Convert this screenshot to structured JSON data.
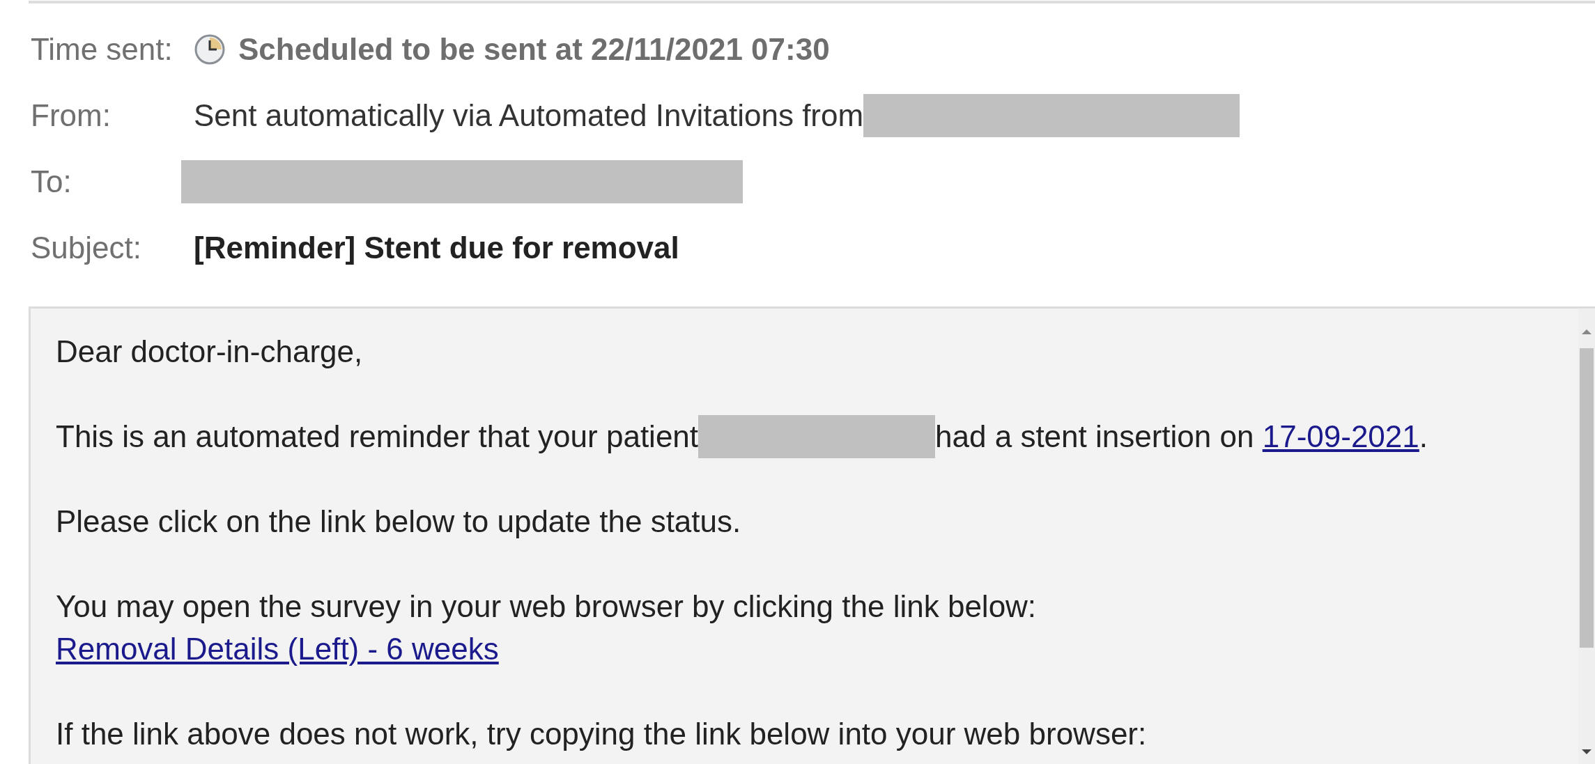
{
  "headers": [
    {
      "label": "Time sent:",
      "kind": "scheduled",
      "value": "Scheduled to be sent at 22/11/2021 07:30",
      "redacted": false
    },
    {
      "label": "From:",
      "kind": "plain",
      "value": "Sent automatically via Automated Invitations from",
      "redacted": true
    },
    {
      "label": "To:",
      "kind": "plain",
      "redacted": true
    },
    {
      "label": "Subject:",
      "kind": "subject",
      "value": "[Reminder] Stent due for removal",
      "redacted": false
    }
  ],
  "body": {
    "paragraphs": [
      {
        "lines": [
          [
            {
              "kind": "text",
              "text": "Dear doctor-in-charge,"
            }
          ]
        ]
      },
      {
        "lines": [
          [
            {
              "kind": "text",
              "text": "This is an automated reminder that your patient"
            },
            {
              "kind": "redacted"
            },
            {
              "kind": "text",
              "text": "had a stent insertion on "
            },
            {
              "kind": "link",
              "text": "17-09-2021"
            },
            {
              "kind": "text",
              "text": "."
            }
          ]
        ]
      },
      {
        "lines": [
          [
            {
              "kind": "text",
              "text": "Please click on the link below to update the status."
            }
          ]
        ]
      },
      {
        "lines": [
          [
            {
              "kind": "text",
              "text": "You may open the survey in your web browser by clicking the link below:"
            }
          ],
          [
            {
              "kind": "link",
              "text": "Removal Details (Left) - 6 weeks"
            }
          ]
        ]
      },
      {
        "lines": [
          [
            {
              "kind": "text",
              "text": "If the link above does not work, try copying the link below into your web browser:"
            }
          ]
        ]
      }
    ]
  }
}
